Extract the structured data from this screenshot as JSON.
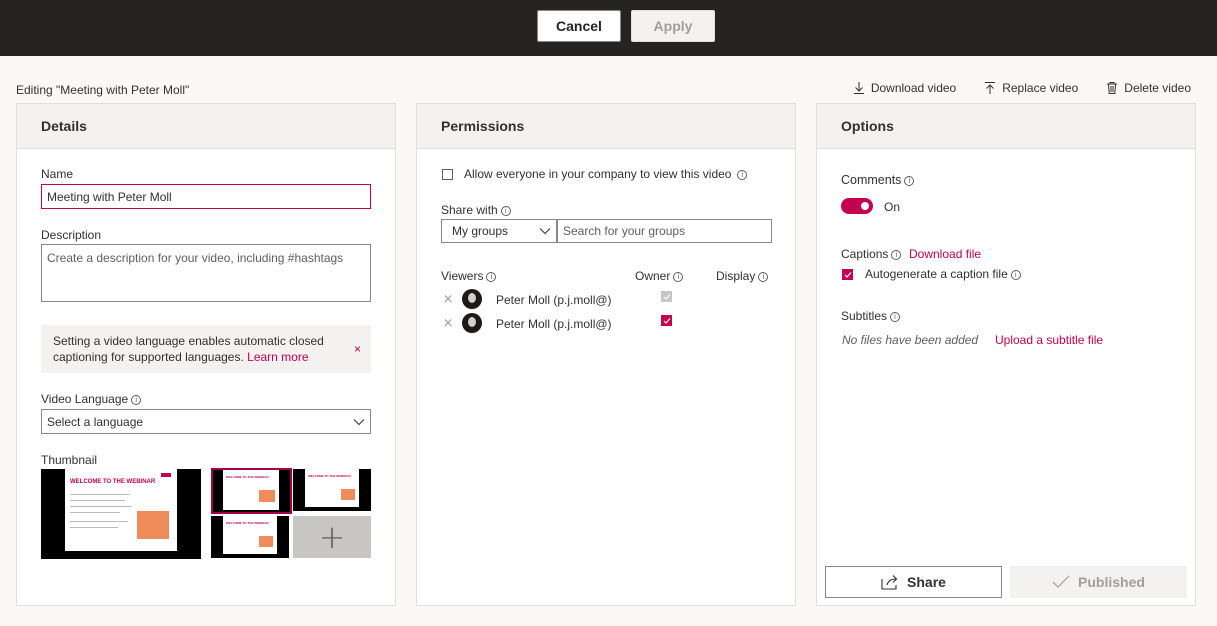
{
  "topbar": {
    "cancel_label": "Cancel",
    "apply_label": "Apply"
  },
  "editing_label": "Editing \"Meeting with Peter Moll\"",
  "actions": {
    "download": "Download video",
    "replace": "Replace video",
    "delete": "Delete video"
  },
  "details": {
    "heading": "Details",
    "name_label": "Name",
    "name_value": "Meeting with Peter Moll",
    "description_label": "Description",
    "description_placeholder": "Create a description for your video, including #hashtags",
    "message_text": "Setting a video language enables automatic closed captioning for supported languages.",
    "message_link": "Learn more",
    "message_close": "×",
    "language_label": "Video Language",
    "language_value": "Select a language",
    "thumbnail_label": "Thumbnail",
    "slide_title": "WELCOME TO THE WEBINAR",
    "add_thumbnail": "+"
  },
  "permissions": {
    "heading": "Permissions",
    "allow_everyone": "Allow everyone in your company to view this video",
    "share_with_label": "Share with",
    "share_scope": "My groups",
    "search_placeholder": "Search for your groups",
    "col_viewers": "Viewers",
    "col_owner": "Owner",
    "col_display": "Display",
    "viewers": [
      {
        "name": "Peter Moll (p.j.moll@)",
        "owner": true,
        "display": false
      },
      {
        "name": "Peter Moll (p.j.moll@)",
        "owner": true,
        "display": false
      }
    ]
  },
  "options": {
    "heading": "Options",
    "comments_label": "Comments",
    "comments_state": "On",
    "captions_label": "Captions",
    "download_file": "Download file",
    "autogenerate": "Autogenerate a caption file",
    "subtitles_label": "Subtitles",
    "no_files": "No files have been added",
    "upload_subtitle": "Upload a subtitle file",
    "share_label": "Share",
    "published_label": "Published"
  },
  "colors": {
    "accent": "#c30052",
    "topbar": "#252423"
  },
  "icons": [
    "download-icon",
    "upload-icon",
    "trash-icon",
    "info-icon",
    "chevron-down-icon",
    "close-icon",
    "checkmark-icon",
    "share-icon",
    "avatar",
    "plus-icon"
  ]
}
